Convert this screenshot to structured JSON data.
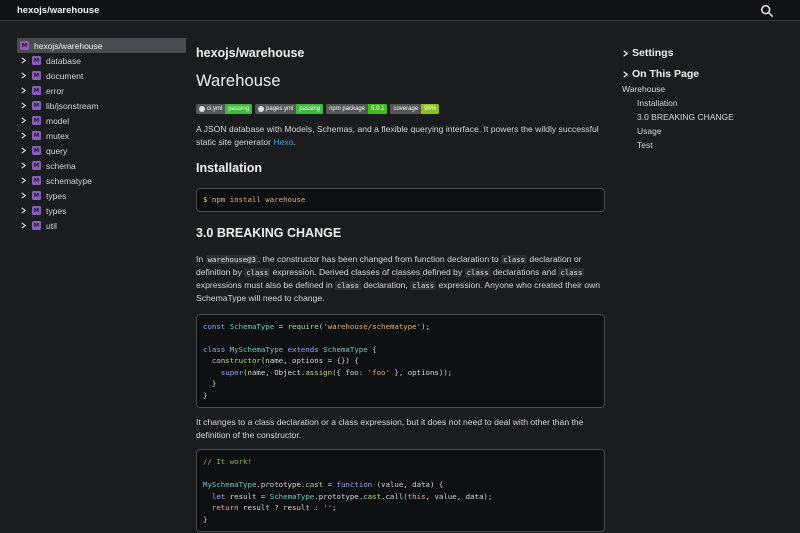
{
  "header": {
    "title": "hexojs/warehouse",
    "search_icon": "search-icon"
  },
  "sidebar": {
    "root": {
      "label": "hexojs/warehouse",
      "badge": "M"
    },
    "items": [
      {
        "label": "database",
        "badge": "M"
      },
      {
        "label": "document",
        "badge": "M"
      },
      {
        "label": "error",
        "badge": "M"
      },
      {
        "label": "lib/jsonstream",
        "badge": "M"
      },
      {
        "label": "model",
        "badge": "M"
      },
      {
        "label": "mutex",
        "badge": "M"
      },
      {
        "label": "query",
        "badge": "M"
      },
      {
        "label": "schema",
        "badge": "M"
      },
      {
        "label": "schematype",
        "badge": "M"
      },
      {
        "label": "types",
        "badge": "M"
      },
      {
        "label": "types",
        "badge": "M"
      },
      {
        "label": "util",
        "badge": "M"
      }
    ]
  },
  "main": {
    "repo": "hexojs/warehouse",
    "title": "Warehouse",
    "badges": [
      {
        "left": "ci.yml",
        "right": "passing",
        "icon": "github-icon"
      },
      {
        "left": "pages.yml",
        "right": "passing",
        "icon": "github-icon"
      },
      {
        "left": "npm package",
        "right": "5.0.1"
      },
      {
        "left": "coverage",
        "right": "98%"
      }
    ],
    "intro": "A JSON database with Models, Schemas, and a flexible querying interface. It powers the wildly successful static site generator ",
    "intro_link": "Hexo",
    "intro_end": ".",
    "installation_heading": "Installation",
    "install_cmd_prompt": "$",
    "install_cmd": "npm install warehouse",
    "breaking_heading": "3.0 BREAKING CHANGE",
    "breaking_p": {
      "t1": "In ",
      "c1": "warehouse@3",
      "t2": ", the constructor has been changed from function declaration to ",
      "c2": "class",
      "t3": " declaration or definition by ",
      "c3": "class",
      "t4": " expression. Derived classes of classes defined by ",
      "c4": "class",
      "t5": " declarations and ",
      "c5": "class",
      "t6": " expressions must also be defined in ",
      "c6": "class",
      "t7": " declaration, ",
      "c7": "class",
      "t8": " expression. Anyone who created their own SchemaType will need to change."
    },
    "code1": {
      "l1_const": "const",
      "l1_name": "SchemaType",
      "l1_eq": " = ",
      "l1_fn": "require",
      "l1_str": "'warehouse/schematype'",
      "l1_end": ";",
      "l3_class": "class",
      "l3_name": "MySchemaType",
      "l3_ext": "extends",
      "l3_base": "SchemaType",
      "l3_brace": " {",
      "l4_fn": "constructor",
      "l4_args": "(name, options = {}) {",
      "l5_super": "super",
      "l5_a": "(name, Object.",
      "l5_assign": "assign",
      "l5_b": "({ foo: ",
      "l5_str": "'foo'",
      "l5_c": " }, options));",
      "l6": "  }",
      "l7": "}"
    },
    "mid_p": "It changes to a class declaration or a class expression, but it does not need to deal with other than the definition of the constructor.",
    "code2": {
      "l1": "// It work!",
      "l3_a": "MySchemaType",
      "l3_b": ".prototype.",
      "l3_cast": "cast",
      "l3_c": " = ",
      "l3_fn": "function",
      "l3_d": " (value, data) {",
      "l4_let": "let",
      "l4_a": " result = ",
      "l4_b": "SchemaType",
      "l4_c": ".prototype.",
      "l4_cast": "cast",
      "l4_d": ".call(",
      "l4_this": "this",
      "l4_e": ", value, data);",
      "l5_ret": "return",
      "l5_a": " result ? result : ",
      "l5_str": "''",
      "l5_end": ";",
      "l6": "}"
    }
  },
  "right": {
    "settings": "Settings",
    "on_this_page": "On This Page",
    "toc": [
      "Warehouse",
      "Installation",
      "3.0 BREAKING CHANGE",
      "Usage",
      "Test"
    ]
  }
}
